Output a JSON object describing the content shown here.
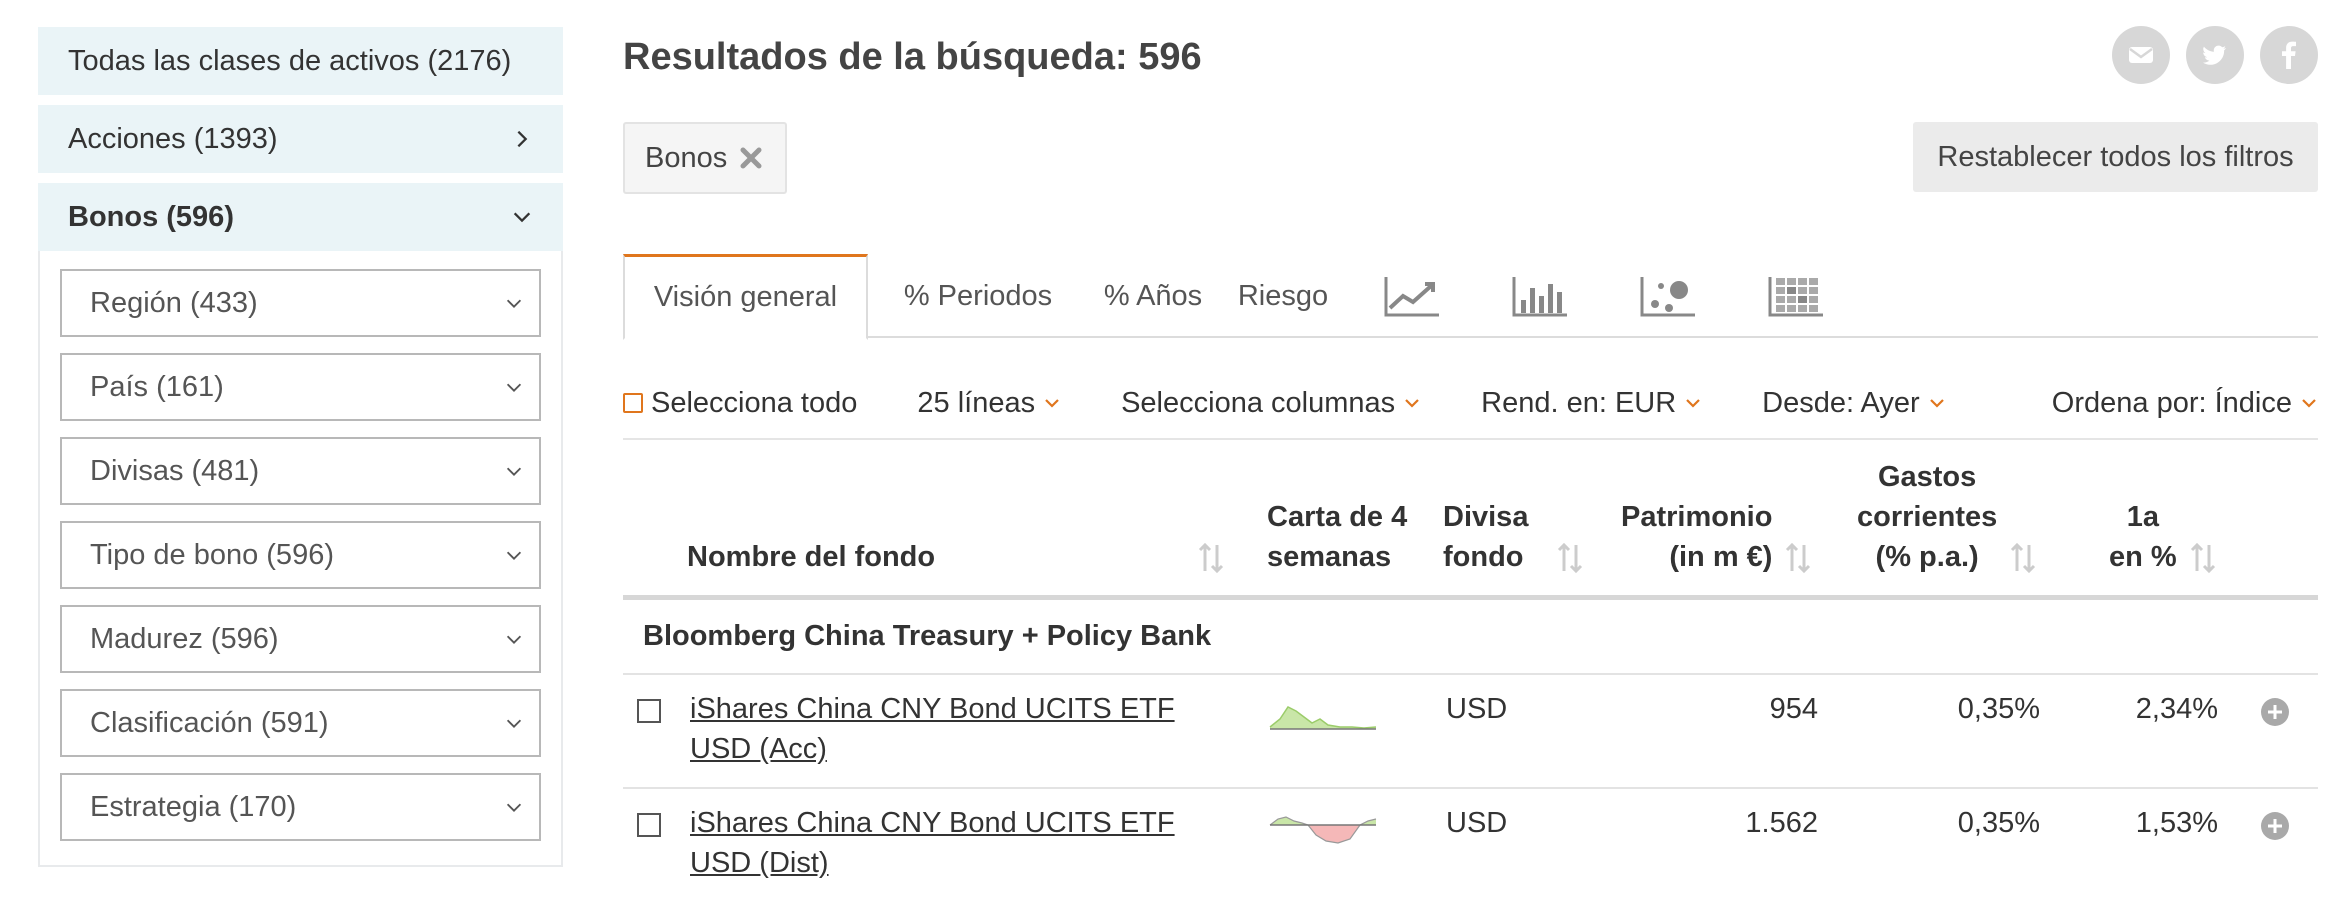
{
  "sidebar": {
    "all_label": "Todas las clases de activos (2176)",
    "items": [
      {
        "label": "Acciones (1393)"
      },
      {
        "label": "Bonos (596)"
      }
    ],
    "filters": [
      {
        "label": "Región (433)"
      },
      {
        "label": "País (161)"
      },
      {
        "label": "Divisas (481)"
      },
      {
        "label": "Tipo de bono (596)"
      },
      {
        "label": "Madurez (596)"
      },
      {
        "label": "Clasificación (591)"
      },
      {
        "label": "Estrategia (170)"
      }
    ]
  },
  "header": {
    "title": "Resultados de la búsqueda: 596",
    "social_icons": [
      "mail-icon",
      "twitter-icon",
      "facebook-icon"
    ]
  },
  "filter_chip": {
    "label": "Bonos"
  },
  "reset_button": {
    "label": "Restablecer todos los filtros"
  },
  "tabs": [
    {
      "label": "Visión general",
      "active": true
    },
    {
      "label": "% Periodos"
    },
    {
      "label": "% Años"
    },
    {
      "label": "Riesgo"
    }
  ],
  "chart_tabs": [
    "line-chart-icon",
    "bar-chart-icon",
    "scatter-chart-icon",
    "heatmap-icon"
  ],
  "toolbar": {
    "select_all": "Selecciona todo",
    "lines": "25 líneas",
    "columns": "Selecciona columnas",
    "currency": "Rend. en: EUR",
    "since": "Desde: Ayer",
    "sort": "Ordena por: Índice"
  },
  "table": {
    "headers": {
      "name": "Nombre del fondo",
      "chart": "Carta de 4\nsemanas",
      "currency": "Divisa\nfondo",
      "aum": "Patrimonio\n(in m €)",
      "fees": "Gastos\ncorrientes\n(% p.a.)",
      "perf": "1a\nen %"
    },
    "group": "Bloomberg China Treasury + Policy Bank",
    "rows": [
      {
        "name": "iShares China CNY Bond UCITS ETF USD (Acc)",
        "currency": "USD",
        "aum": "954",
        "fees": "0,35%",
        "perf": "2,34%"
      },
      {
        "name": "iShares China CNY Bond UCITS ETF USD (Dist)",
        "currency": "USD",
        "aum": "1.562",
        "fees": "0,35%",
        "perf": "1,53%"
      }
    ]
  },
  "colors": {
    "accent": "#e0761d",
    "sidebar_bg": "#eaf4f7",
    "spark_positive": "#c9e6a8",
    "spark_negative": "#f5b8b8"
  }
}
